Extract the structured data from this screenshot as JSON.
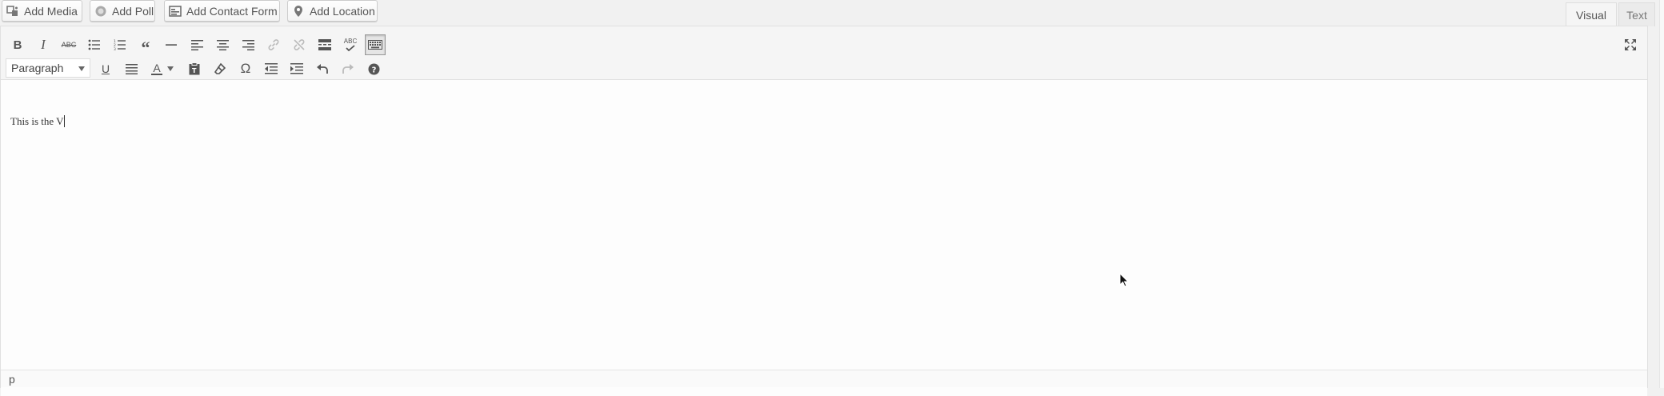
{
  "media_buttons": {
    "add_media": "Add Media",
    "add_poll": "Add Poll",
    "add_contact_form": "Add Contact Form",
    "add_location": "Add Location"
  },
  "tabs": {
    "visual": "Visual",
    "text": "Text"
  },
  "toolbar": {
    "row1": [
      "bold-icon",
      "italic-icon",
      "strikethrough-icon",
      "bullet-list-icon",
      "numbered-list-icon",
      "blockquote-icon",
      "horizontal-rule-icon",
      "align-left-icon",
      "align-center-icon",
      "align-right-icon",
      "insert-link-icon",
      "remove-link-icon",
      "read-more-icon",
      "spellcheck-icon",
      "toolbar-toggle-icon"
    ],
    "row2": [
      "underline-icon",
      "justify-icon",
      "text-color-icon",
      "paste-as-text-icon",
      "clear-formatting-icon",
      "special-character-icon",
      "decrease-indent-icon",
      "increase-indent-icon",
      "undo-icon",
      "redo-icon",
      "help-icon"
    ],
    "format_selected": "Paragraph",
    "spellcheck_label": "ABC",
    "strike_label": "ABC"
  },
  "editor": {
    "content": "This is the V"
  },
  "statusbar": {
    "path": "p"
  },
  "colors": {
    "toolbar_bg": "#f5f5f5",
    "border": "#e0e0e0",
    "active_button_bg": "#e5e5e5"
  }
}
